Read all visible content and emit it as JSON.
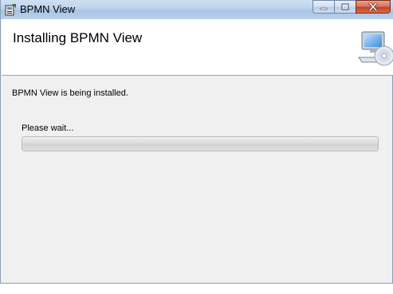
{
  "window": {
    "title": "BPMN View",
    "app_icon": "installer-icon",
    "minimize_icon": "minimize-icon",
    "maximize_icon": "maximize-icon",
    "close_icon": "close-icon"
  },
  "header": {
    "title": "Installing BPMN View",
    "icon": "computer-cd-icon"
  },
  "content": {
    "status_text": "BPMN View is being installed.",
    "wait_text": "Please wait...",
    "progress": 0
  },
  "colors": {
    "titlebar": "#bcd2ec",
    "close_button": "#c3452b",
    "dialog_background": "#f0f0f0"
  }
}
